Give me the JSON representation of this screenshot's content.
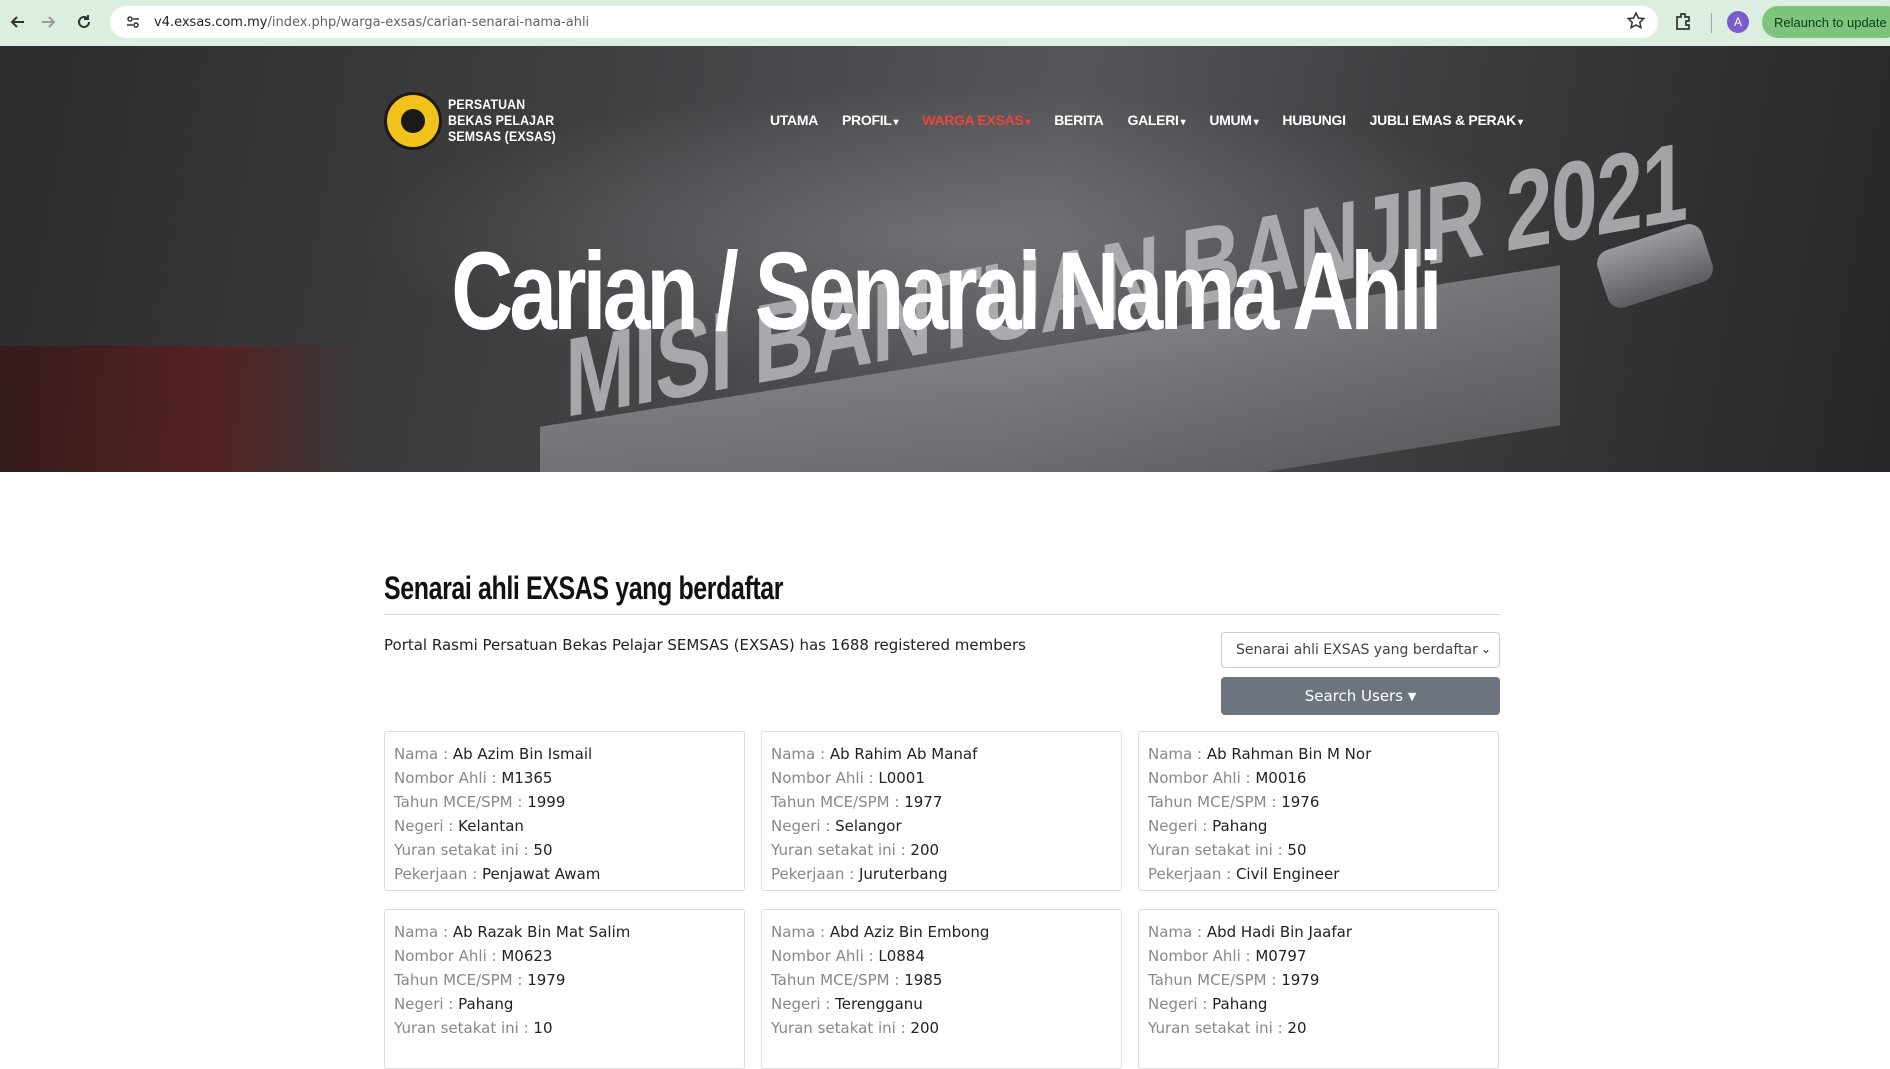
{
  "browser": {
    "url_host": "v4.exsas.com.my",
    "url_path": "/index.php/warga-exsas/carian-senarai-nama-ahli",
    "profile_initial": "A",
    "relaunch_label": "Relaunch to update"
  },
  "site": {
    "brand_lines": [
      "PERSATUAN",
      "BEKAS PELAJAR",
      "SEMSAS (EXSAS)"
    ],
    "nav": [
      {
        "label": "UTAMA",
        "caret": false,
        "active": false
      },
      {
        "label": "PROFIL",
        "caret": true,
        "active": false
      },
      {
        "label": "WARGA EXSAS",
        "caret": true,
        "active": true
      },
      {
        "label": "BERITA",
        "caret": false,
        "active": false
      },
      {
        "label": "GALERI",
        "caret": true,
        "active": false
      },
      {
        "label": "UMUM",
        "caret": true,
        "active": false
      },
      {
        "label": "HUBUNGI",
        "caret": false,
        "active": false
      },
      {
        "label": "JUBLI EMAS & PERAK",
        "caret": true,
        "active": false
      }
    ],
    "hero_title": "Carian / Senarai Nama Ahli",
    "hero_bg_text": "MISI BANTUAN BANJIR 2021"
  },
  "main": {
    "section_title": "Senarai ahli EXSAS yang berdaftar",
    "summary": "Portal Rasmi Persatuan Bekas Pelajar SEMSAS (EXSAS) has 1688 registered members",
    "filter_selected": "Senarai ahli EXSAS yang berdaftar",
    "search_button": "Search Users",
    "labels": {
      "nama": "Nama : ",
      "nombor": "Nombor Ahli : ",
      "tahun": "Tahun MCE/SPM : ",
      "negeri": "Negeri : ",
      "yuran": "Yuran setakat ini : ",
      "pekerjaan": "Pekerjaan : "
    },
    "members": [
      {
        "nama": "Ab Azim Bin Ismail",
        "nombor": "M1365",
        "tahun": "1999",
        "negeri": "Kelantan",
        "yuran": "50",
        "pekerjaan": "Penjawat Awam"
      },
      {
        "nama": "Ab Rahim Ab Manaf",
        "nombor": "L0001",
        "tahun": "1977",
        "negeri": "Selangor",
        "yuran": "200",
        "pekerjaan": "Juruterbang"
      },
      {
        "nama": "Ab Rahman Bin M Nor",
        "nombor": "M0016",
        "tahun": "1976",
        "negeri": "Pahang",
        "yuran": "50",
        "pekerjaan": "Civil Engineer"
      },
      {
        "nama": "Ab Razak Bin Mat Salim",
        "nombor": "M0623",
        "tahun": "1979",
        "negeri": "Pahang",
        "yuran": "10",
        "pekerjaan": ""
      },
      {
        "nama": "Abd Aziz Bin Embong",
        "nombor": "L0884",
        "tahun": "1985",
        "negeri": "Terengganu",
        "yuran": "200",
        "pekerjaan": ""
      },
      {
        "nama": "Abd Hadi Bin Jaafar",
        "nombor": "M0797",
        "tahun": "1979",
        "negeri": "Pahang",
        "yuran": "20",
        "pekerjaan": ""
      }
    ]
  }
}
